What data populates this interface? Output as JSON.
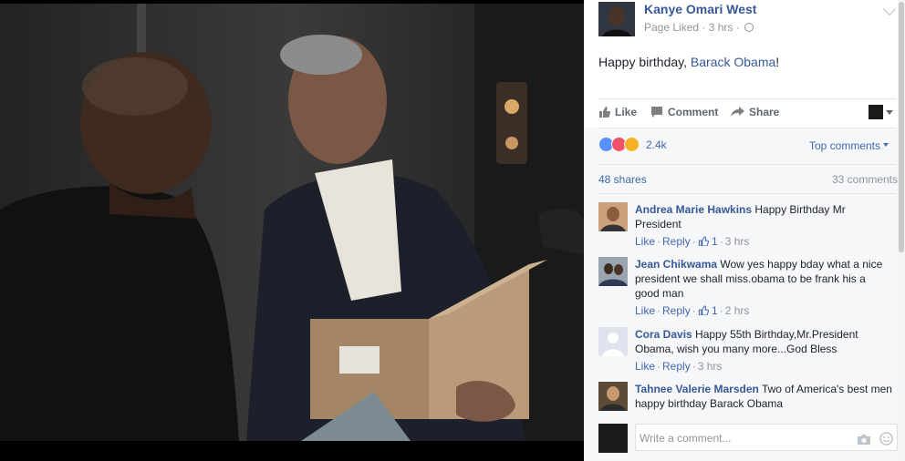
{
  "post": {
    "author": "Kanye Omari West",
    "meta": "Page Liked · 3 hrs ·",
    "text_prefix": "Happy birthday, ",
    "text_link": "Barack Obama",
    "text_suffix": "!"
  },
  "actions": {
    "like": "Like",
    "comment": "Comment",
    "share": "Share"
  },
  "stats": {
    "reaction_count": "2.4k",
    "top_comments": "Top comments",
    "shares": "48 shares",
    "comments": "33 comments"
  },
  "comments": [
    {
      "name": "Andrea Marie Hawkins",
      "text": "Happy Birthday Mr President",
      "like": "Like",
      "reply": "Reply",
      "likes": "1",
      "time": "3 hrs"
    },
    {
      "name": "Jean Chikwama",
      "text": "Wow yes happy bday what a nice president we shall miss.obama to be frank his a good man",
      "like": "Like",
      "reply": "Reply",
      "likes": "1",
      "time": "2 hrs"
    },
    {
      "name": "Cora Davis",
      "text": "Happy 55th Birthday,Mr.President Obama, wish you many more...God Bless",
      "like": "Like",
      "reply": "Reply",
      "time": "3 hrs"
    },
    {
      "name": "Tahnee Valerie Marsden",
      "text": "Two of America's best men happy birthday Barack Obama"
    }
  ],
  "compose": {
    "placeholder": "Write a comment..."
  },
  "colors": {
    "link": "#365899",
    "accent": "#4267b2",
    "muted": "#90949c",
    "panel_grey": "#f6f7f9"
  },
  "icons": [
    "thumbs-up-icon",
    "comment-icon",
    "share-icon",
    "globe-icon",
    "chevron-down-icon",
    "like-reaction-icon",
    "love-reaction-icon",
    "wow-reaction-icon",
    "camera-icon",
    "sticker-icon"
  ]
}
